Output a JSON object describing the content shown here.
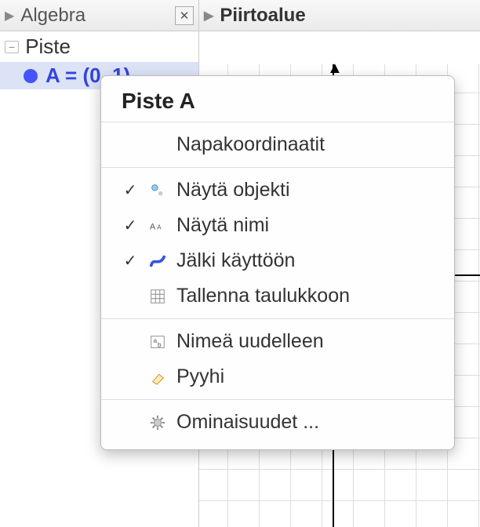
{
  "panels": {
    "algebra": {
      "title": "Algebra"
    },
    "graph": {
      "title": "Piirtoalue"
    }
  },
  "tree": {
    "category": "Piste",
    "point": {
      "text": "A = (0, 1)"
    }
  },
  "menu": {
    "title": "Piste A",
    "polar": "Napakoordinaatit",
    "show_object": "Näytä objekti",
    "show_label": "Näytä nimi",
    "trace_on": "Jälki käyttöön",
    "record_to_spreadsheet": "Tallenna taulukkoon",
    "rename": "Nimeä uudelleen",
    "delete": "Pyyhi",
    "properties": "Ominaisuudet ..."
  }
}
